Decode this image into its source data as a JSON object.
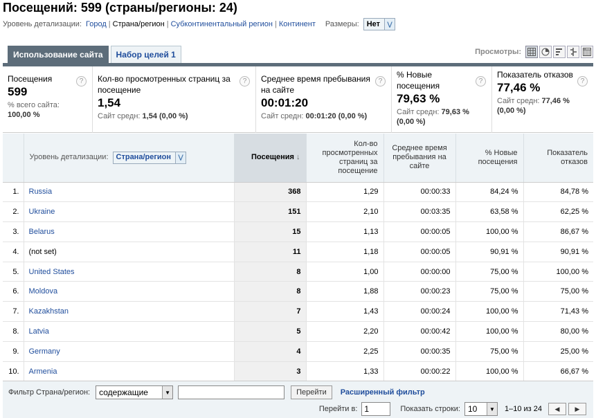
{
  "title": "Посещений: 599 (страны/регионы: 24)",
  "detail": {
    "label": "Уровень детализации:",
    "items": [
      {
        "label": "Город",
        "link": true
      },
      {
        "label": "Страна/регион",
        "link": false
      },
      {
        "label": "Субконтинентальный регион",
        "link": true
      },
      {
        "label": "Континент",
        "link": true
      }
    ],
    "dims_label": "Размеры:",
    "dims_value": "Нет"
  },
  "tabs": [
    {
      "label": "Использование сайта",
      "active": true
    },
    {
      "label": "Набор целей 1",
      "active": false
    }
  ],
  "views_label": "Просмотры:",
  "summary": [
    {
      "label": "Посещения",
      "value": "599",
      "sub1": "% всего сайта:",
      "sub2": "100,00 %"
    },
    {
      "label": "Кол-во просмотренных страниц за посещение",
      "value": "1,54",
      "sub1": "Сайт средн:",
      "sub2": "1,54 (0,00 %)"
    },
    {
      "label": "Среднее время пребывания на сайте",
      "value": "00:01:20",
      "sub1": "Сайт средн:",
      "sub2": "00:01:20 (0,00 %)"
    },
    {
      "label": "% Новые посещения",
      "value": "79,63 %",
      "sub1": "Сайт средн:",
      "sub2": "79,63 % (0,00 %)"
    },
    {
      "label": "Показатель отказов",
      "value": "77,46 %",
      "sub1": "Сайт средн:",
      "sub2": "77,46 % (0,00 %)"
    }
  ],
  "table": {
    "detail_label": "Уровень детализации:",
    "detail_value": "Страна/регион",
    "columns": [
      "Посещения",
      "Кол-во просмотренных страниц за посещение",
      "Среднее время пребывания на сайте",
      "% Новые посещения",
      "Показатель отказов"
    ],
    "rows": [
      {
        "idx": "1.",
        "name": "Russia",
        "link": true,
        "visits": "368",
        "pages": "1,29",
        "time": "00:00:33",
        "new": "84,24 %",
        "bounce": "84,78 %"
      },
      {
        "idx": "2.",
        "name": "Ukraine",
        "link": true,
        "visits": "151",
        "pages": "2,10",
        "time": "00:03:35",
        "new": "63,58 %",
        "bounce": "62,25 %"
      },
      {
        "idx": "3.",
        "name": "Belarus",
        "link": true,
        "visits": "15",
        "pages": "1,13",
        "time": "00:00:05",
        "new": "100,00 %",
        "bounce": "86,67 %"
      },
      {
        "idx": "4.",
        "name": "(not set)",
        "link": false,
        "visits": "11",
        "pages": "1,18",
        "time": "00:00:05",
        "new": "90,91 %",
        "bounce": "90,91 %"
      },
      {
        "idx": "5.",
        "name": "United States",
        "link": true,
        "visits": "8",
        "pages": "1,00",
        "time": "00:00:00",
        "new": "75,00 %",
        "bounce": "100,00 %"
      },
      {
        "idx": "6.",
        "name": "Moldova",
        "link": true,
        "visits": "8",
        "pages": "1,88",
        "time": "00:00:23",
        "new": "75,00 %",
        "bounce": "75,00 %"
      },
      {
        "idx": "7.",
        "name": "Kazakhstan",
        "link": true,
        "visits": "7",
        "pages": "1,43",
        "time": "00:00:24",
        "new": "100,00 %",
        "bounce": "71,43 %"
      },
      {
        "idx": "8.",
        "name": "Latvia",
        "link": true,
        "visits": "5",
        "pages": "2,20",
        "time": "00:00:42",
        "new": "100,00 %",
        "bounce": "80,00 %"
      },
      {
        "idx": "9.",
        "name": "Germany",
        "link": true,
        "visits": "4",
        "pages": "2,25",
        "time": "00:00:35",
        "new": "75,00 %",
        "bounce": "25,00 %"
      },
      {
        "idx": "10.",
        "name": "Armenia",
        "link": true,
        "visits": "3",
        "pages": "1,33",
        "time": "00:00:22",
        "new": "100,00 %",
        "bounce": "66,67 %"
      }
    ]
  },
  "footer": {
    "filter_label": "Фильтр Страна/регион:",
    "filter_mode": "содержащие",
    "filter_value": "",
    "go_button": "Перейти",
    "advanced": "Расширенный фильтр",
    "goto_label": "Перейти в:",
    "goto_value": "1",
    "rows_label": "Показать строки:",
    "rows_value": "10",
    "range": "1–10 из 24"
  },
  "colors": {
    "accent": "#5d6d7a",
    "link": "#1f4d9c",
    "header_bg": "#eef3f6",
    "sorted_bg": "#d7dde2"
  }
}
